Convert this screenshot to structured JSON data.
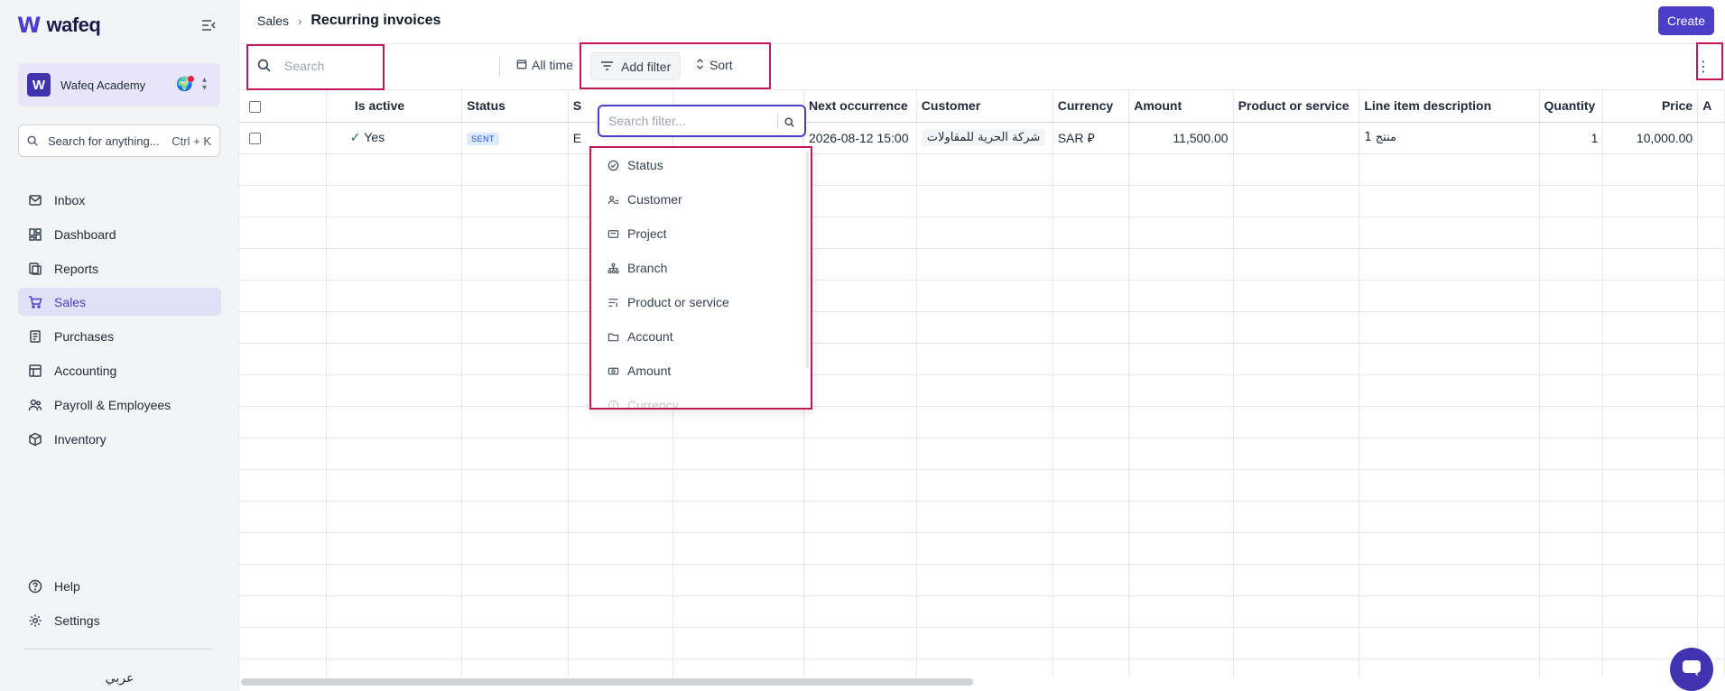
{
  "app": {
    "logo_text": "wafeq"
  },
  "sidebar": {
    "org_name": "Wafeq Academy",
    "org_initial": "W",
    "search_placeholder": "Search for anything...",
    "search_shortcut": "Ctrl + K",
    "items": [
      {
        "label": "Inbox",
        "icon": "inbox-icon"
      },
      {
        "label": "Dashboard",
        "icon": "dashboard-icon"
      },
      {
        "label": "Reports",
        "icon": "reports-icon"
      },
      {
        "label": "Sales",
        "icon": "cart-icon",
        "active": true
      },
      {
        "label": "Purchases",
        "icon": "receipt-icon"
      },
      {
        "label": "Accounting",
        "icon": "ledger-icon"
      },
      {
        "label": "Payroll & Employees",
        "icon": "people-icon"
      },
      {
        "label": "Inventory",
        "icon": "box-icon"
      }
    ],
    "bottom_items": [
      {
        "label": "Help",
        "icon": "help-icon"
      },
      {
        "label": "Settings",
        "icon": "gear-icon"
      }
    ],
    "language": "عربي"
  },
  "header": {
    "breadcrumb_parent": "Sales",
    "breadcrumb_separator": "›",
    "title": "Recurring invoices",
    "create_label": "Create"
  },
  "toolbar": {
    "search_placeholder": "Search",
    "time_filter": "All time",
    "add_filter_label": "Add filter",
    "sort_label": "Sort"
  },
  "table": {
    "columns": [
      "Is active",
      "Status",
      "S",
      "",
      "Next occurrence",
      "Customer",
      "Currency",
      "Amount",
      "Product or service",
      "Line item description",
      "Quantity",
      "Price",
      "A"
    ],
    "rows": [
      {
        "is_active": "Yes",
        "status": "SENT",
        "col3": "E",
        "col4": "",
        "next_occurrence": "2026-08-12 15:00",
        "customer": "شركة الحرية للمقاولات",
        "currency": "SAR ⃁",
        "amount": "11,500.00",
        "product": "",
        "description": "منتج 1",
        "quantity": "1",
        "price": "10,000.00"
      }
    ],
    "empty_rows": 17
  },
  "filter_dropdown": {
    "search_placeholder": "Search filter...",
    "items": [
      {
        "label": "Status",
        "icon": "status-check-icon"
      },
      {
        "label": "Customer",
        "icon": "customer-icon"
      },
      {
        "label": "Project",
        "icon": "project-icon"
      },
      {
        "label": "Branch",
        "icon": "branch-icon"
      },
      {
        "label": "Product or service",
        "icon": "product-icon"
      },
      {
        "label": "Account",
        "icon": "folder-icon"
      },
      {
        "label": "Amount",
        "icon": "money-icon"
      },
      {
        "label": "Currency",
        "icon": "currency-icon"
      }
    ]
  },
  "colors": {
    "accent": "#4b3fc7",
    "highlight_box": "#c2185b",
    "active_nav_bg": "#e2e0f6",
    "sidebar_bg": "#f3f4f6"
  }
}
